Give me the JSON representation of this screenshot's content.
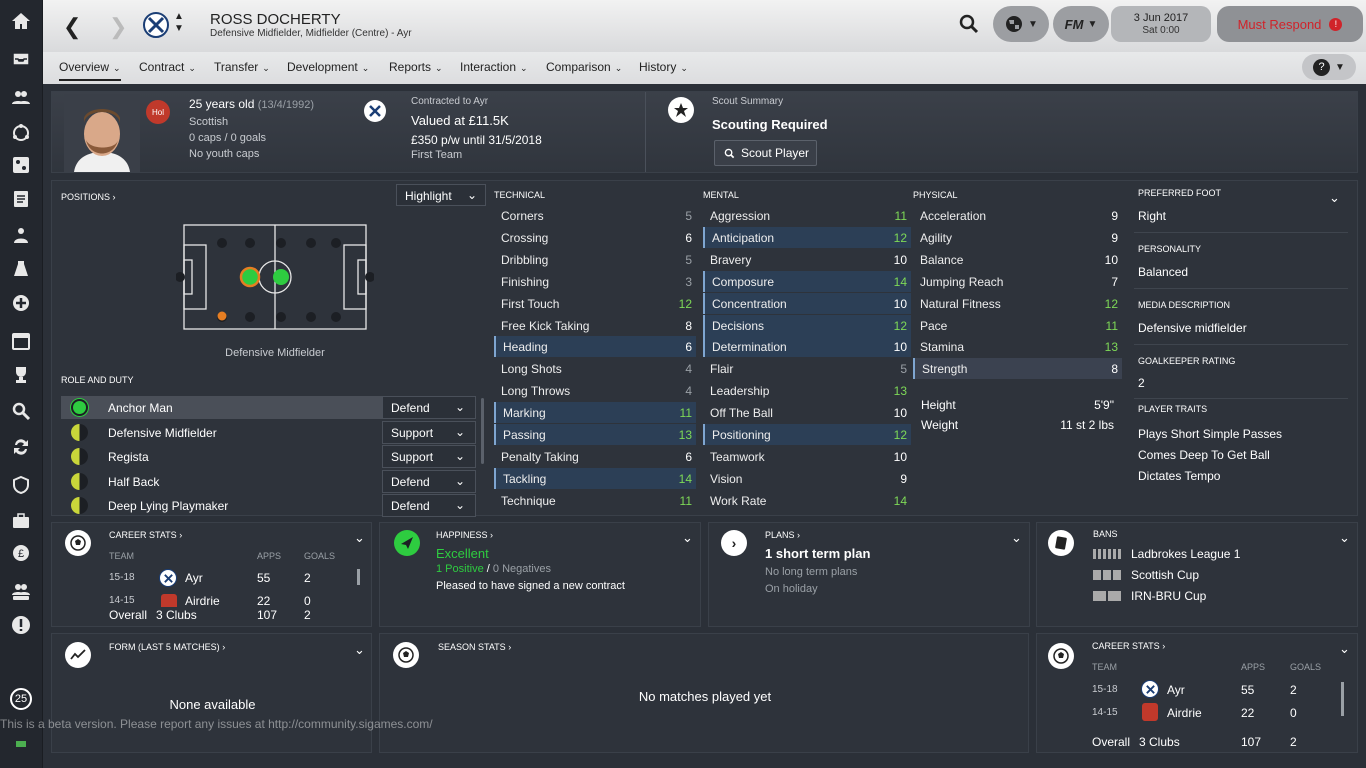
{
  "player": {
    "name": "ROSS DOCHERTY",
    "subtitle": "Defensive Midfielder, Midfielder (Centre) - Ayr"
  },
  "topbar": {
    "date": "3 Jun 2017",
    "time": "Sat 0:00",
    "must_respond": "Must Respond",
    "fm_label": "FM"
  },
  "tabs": [
    "Overview",
    "Contract",
    "Transfer",
    "Development",
    "Reports",
    "Interaction",
    "Comparison",
    "History"
  ],
  "info": {
    "age": "25 years old",
    "dob": "(13/4/1992)",
    "nationality": "Scottish",
    "caps": "0 caps / 0 goals",
    "youth": "No youth caps",
    "flag": "Hol",
    "contract_label": "Contracted to Ayr",
    "value": "Valued at £11.5K",
    "wage": "£350 p/w until 31/5/2018",
    "squad": "First Team",
    "scout_label": "Scout Summary",
    "scout_status": "Scouting Required",
    "scout_button": "Scout Player"
  },
  "positions": {
    "title": "POSITIONS",
    "highlight": "Highlight",
    "current": "Defensive Midfielder",
    "role_title": "ROLE AND DUTY",
    "roles": [
      {
        "name": "Anchor Man",
        "duty": "Defend"
      },
      {
        "name": "Defensive Midfielder",
        "duty": "Support"
      },
      {
        "name": "Regista",
        "duty": "Support"
      },
      {
        "name": "Half Back",
        "duty": "Defend"
      },
      {
        "name": "Deep Lying Playmaker",
        "duty": "Defend"
      }
    ]
  },
  "technical": {
    "title": "TECHNICAL",
    "attrs": [
      {
        "n": "Corners",
        "v": "5"
      },
      {
        "n": "Crossing",
        "v": "6"
      },
      {
        "n": "Dribbling",
        "v": "5"
      },
      {
        "n": "Finishing",
        "v": "3"
      },
      {
        "n": "First Touch",
        "v": "12"
      },
      {
        "n": "Free Kick Taking",
        "v": "8"
      },
      {
        "n": "Heading",
        "v": "6"
      },
      {
        "n": "Long Shots",
        "v": "4"
      },
      {
        "n": "Long Throws",
        "v": "4"
      },
      {
        "n": "Marking",
        "v": "11"
      },
      {
        "n": "Passing",
        "v": "13"
      },
      {
        "n": "Penalty Taking",
        "v": "6"
      },
      {
        "n": "Tackling",
        "v": "14"
      },
      {
        "n": "Technique",
        "v": "11"
      }
    ]
  },
  "mental": {
    "title": "MENTAL",
    "attrs": [
      {
        "n": "Aggression",
        "v": "11"
      },
      {
        "n": "Anticipation",
        "v": "12"
      },
      {
        "n": "Bravery",
        "v": "10"
      },
      {
        "n": "Composure",
        "v": "14"
      },
      {
        "n": "Concentration",
        "v": "10"
      },
      {
        "n": "Decisions",
        "v": "12"
      },
      {
        "n": "Determination",
        "v": "10"
      },
      {
        "n": "Flair",
        "v": "5"
      },
      {
        "n": "Leadership",
        "v": "13"
      },
      {
        "n": "Off The Ball",
        "v": "10"
      },
      {
        "n": "Positioning",
        "v": "12"
      },
      {
        "n": "Teamwork",
        "v": "10"
      },
      {
        "n": "Vision",
        "v": "9"
      },
      {
        "n": "Work Rate",
        "v": "14"
      }
    ]
  },
  "physical": {
    "title": "PHYSICAL",
    "attrs": [
      {
        "n": "Acceleration",
        "v": "9"
      },
      {
        "n": "Agility",
        "v": "9"
      },
      {
        "n": "Balance",
        "v": "10"
      },
      {
        "n": "Jumping Reach",
        "v": "7"
      },
      {
        "n": "Natural Fitness",
        "v": "12"
      },
      {
        "n": "Pace",
        "v": "11"
      },
      {
        "n": "Stamina",
        "v": "13"
      },
      {
        "n": "Strength",
        "v": "8"
      }
    ],
    "height_label": "Height",
    "height": "5'9\"",
    "weight_label": "Weight",
    "weight": "11 st 2 lbs"
  },
  "side": {
    "foot_label": "PREFERRED FOOT",
    "foot": "Right",
    "pers_label": "PERSONALITY",
    "pers": "Balanced",
    "media_label": "MEDIA DESCRIPTION",
    "media": "Defensive midfielder",
    "gk_label": "GOALKEEPER RATING",
    "gk": "2",
    "traits_label": "PLAYER TRAITS",
    "traits": [
      "Plays Short Simple Passes",
      "Comes Deep To Get Ball",
      "Dictates Tempo"
    ]
  },
  "career": {
    "title": "CAREER STATS",
    "team": "TEAM",
    "apps": "APPS",
    "goals": "GOALS",
    "rows": [
      {
        "season": "15-18",
        "club": "Ayr",
        "apps": "55",
        "goals": "2"
      },
      {
        "season": "14-15",
        "club": "Airdrie",
        "apps": "22",
        "goals": "0"
      }
    ],
    "overall": "Overall",
    "clubs": "3 Clubs",
    "total_apps": "107",
    "total_goals": "2"
  },
  "happiness": {
    "title": "HAPPINESS",
    "status": "Excellent",
    "positives": "1 Positive",
    "sep": "/",
    "negatives": "0 Negatives",
    "note": "Pleased to have signed a new contract"
  },
  "plans": {
    "title": "PLANS",
    "main": "1 short term plan",
    "long": "No long term plans",
    "holiday": "On holiday"
  },
  "bans": {
    "title": "BANS",
    "items": [
      "Ladbrokes League 1",
      "Scottish Cup",
      "IRN-BRU Cup"
    ]
  },
  "form": {
    "title": "FORM (LAST 5 MATCHES)",
    "empty": "None available"
  },
  "season": {
    "title": "SEASON STATS",
    "empty": "No matches played yet"
  },
  "footer": {
    "beta": "This is a beta version. Please report any issues at http://community.sigames.com/",
    "badge": "25"
  }
}
